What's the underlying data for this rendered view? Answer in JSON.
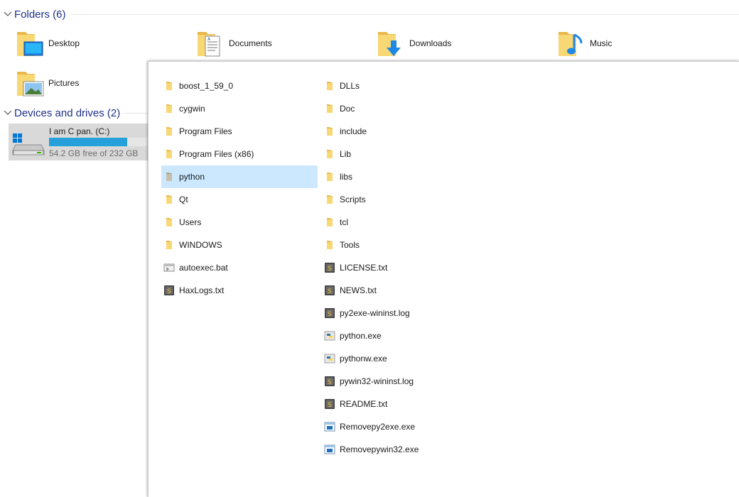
{
  "sections": {
    "folders_header": "Folders (6)",
    "drives_header": "Devices and drives (2)"
  },
  "folders": [
    {
      "label": "Desktop",
      "icon": "desktop-folder-icon"
    },
    {
      "label": "Documents",
      "icon": "documents-folder-icon"
    },
    {
      "label": "Downloads",
      "icon": "downloads-folder-icon"
    },
    {
      "label": "Music",
      "icon": "music-folder-icon"
    },
    {
      "label": "Pictures",
      "icon": "pictures-folder-icon"
    }
  ],
  "drive": {
    "name": "I am C pan. (C:)",
    "free_text": "54.2 GB free of 232 GB",
    "used_fraction": 0.766,
    "bar_color": "#26a0da"
  },
  "popup": {
    "column1": [
      {
        "label": "boost_1_59_0",
        "icon": "folder-icon"
      },
      {
        "label": "cygwin",
        "icon": "folder-icon"
      },
      {
        "label": "Program Files",
        "icon": "folder-icon"
      },
      {
        "label": "Program Files (x86)",
        "icon": "folder-icon"
      },
      {
        "label": "python",
        "icon": "folder-icon",
        "selected": true
      },
      {
        "label": "Qt",
        "icon": "folder-icon"
      },
      {
        "label": "Users",
        "icon": "folder-icon"
      },
      {
        "label": "WINDOWS",
        "icon": "folder-icon"
      },
      {
        "label": "autoexec.bat",
        "icon": "batch-file-icon"
      },
      {
        "label": "HaxLogs.txt",
        "icon": "text-file-icon"
      }
    ],
    "column2": [
      {
        "label": "DLLs",
        "icon": "folder-icon"
      },
      {
        "label": "Doc",
        "icon": "folder-icon"
      },
      {
        "label": "include",
        "icon": "folder-icon"
      },
      {
        "label": "Lib",
        "icon": "folder-icon"
      },
      {
        "label": "libs",
        "icon": "folder-icon"
      },
      {
        "label": "Scripts",
        "icon": "folder-icon"
      },
      {
        "label": "tcl",
        "icon": "folder-icon"
      },
      {
        "label": "Tools",
        "icon": "folder-icon"
      },
      {
        "label": "LICENSE.txt",
        "icon": "text-file-icon"
      },
      {
        "label": "NEWS.txt",
        "icon": "text-file-icon"
      },
      {
        "label": "py2exe-wininst.log",
        "icon": "text-file-icon"
      },
      {
        "label": "python.exe",
        "icon": "python-exe-icon"
      },
      {
        "label": "pythonw.exe",
        "icon": "python-exe-icon"
      },
      {
        "label": "pywin32-wininst.log",
        "icon": "text-file-icon"
      },
      {
        "label": "README.txt",
        "icon": "text-file-icon"
      },
      {
        "label": "Removepy2exe.exe",
        "icon": "app-exe-icon"
      },
      {
        "label": "Removepywin32.exe",
        "icon": "app-exe-icon"
      }
    ]
  },
  "colors": {
    "header_text": "#1e3287",
    "selection": "#cce8ff",
    "folder_yellow": "#f8d775"
  }
}
